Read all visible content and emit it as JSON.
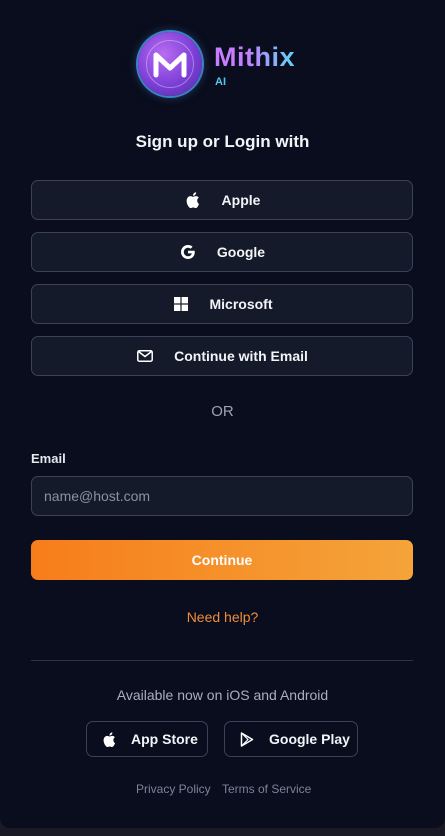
{
  "brand": {
    "name": "Mithix",
    "sub": "AI"
  },
  "heading": "Sign up or Login with",
  "sso": [
    {
      "label": "Apple",
      "icon": "apple-icon"
    },
    {
      "label": "Google",
      "icon": "google-icon"
    },
    {
      "label": "Microsoft",
      "icon": "microsoft-icon"
    },
    {
      "label": "Continue with Email",
      "icon": "mail-icon"
    }
  ],
  "or_text": "OR",
  "email": {
    "label": "Email",
    "placeholder": "name@host.com",
    "value": ""
  },
  "continue_label": "Continue",
  "help_label": "Need help?",
  "availability": "Available now on iOS and Android",
  "stores": [
    {
      "label": "App Store",
      "icon": "apple-icon"
    },
    {
      "label": "Google Play",
      "icon": "play-icon"
    }
  ],
  "footer": {
    "privacy": "Privacy Policy",
    "terms": "Terms of Service"
  },
  "colors": {
    "background": "#090d1d",
    "accent": "#f77d1a",
    "accent_end": "#f4a43a",
    "help_link": "#f28c3a",
    "brand_gradient_start": "#c77dff",
    "brand_gradient_end": "#5fd3f3"
  }
}
